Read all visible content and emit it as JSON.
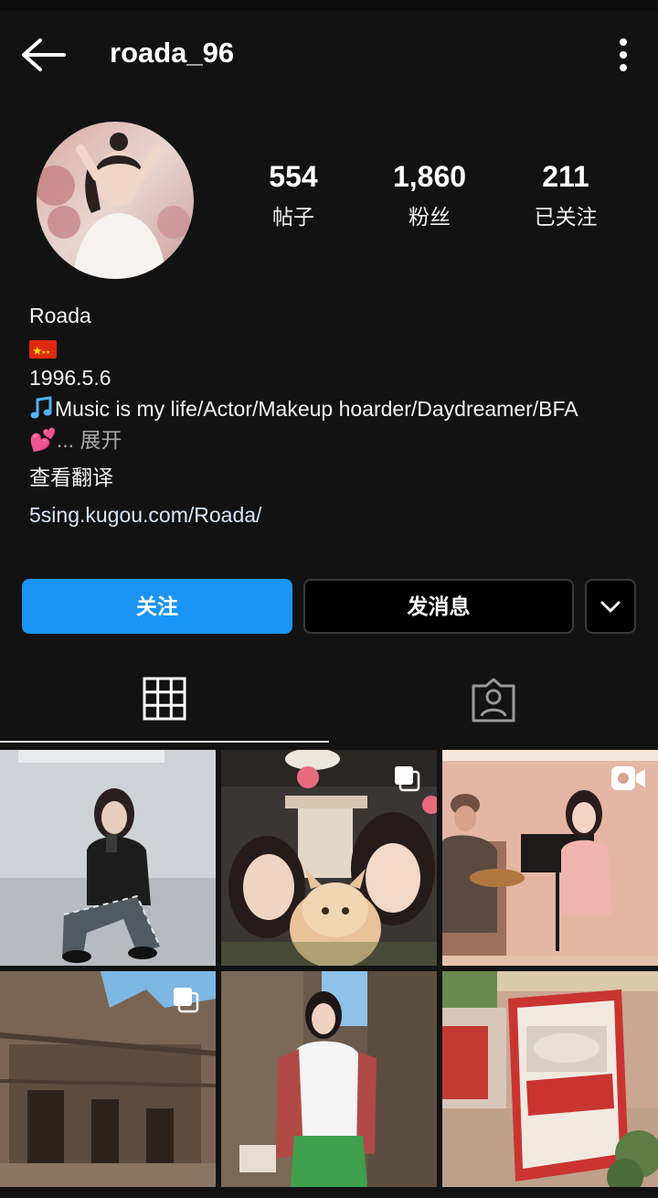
{
  "header": {
    "username": "roada_96"
  },
  "stats": {
    "posts": {
      "value": "554",
      "label": "帖子"
    },
    "followers": {
      "value": "1,860",
      "label": "粉丝"
    },
    "following": {
      "value": "211",
      "label": "已关注"
    }
  },
  "bio": {
    "name": "Roada",
    "birthday": "1996.5.6",
    "line": "Music is my life/Actor/Makeup hoarder/Daydreamer/BFA",
    "more": "... 展开",
    "translate": "查看翻译",
    "link": "5sing.kugou.com/Roada/"
  },
  "actions": {
    "follow": "关注",
    "message": "发消息"
  },
  "colors": {
    "background": "#121212",
    "follow_button": "#1a95f5",
    "link_text": "#d9e6f7"
  },
  "icons": [
    "back-arrow-icon",
    "more-vert-icon",
    "chevron-down-icon",
    "grid-icon",
    "tagged-person-icon",
    "carousel-icon",
    "reel-video-icon"
  ]
}
